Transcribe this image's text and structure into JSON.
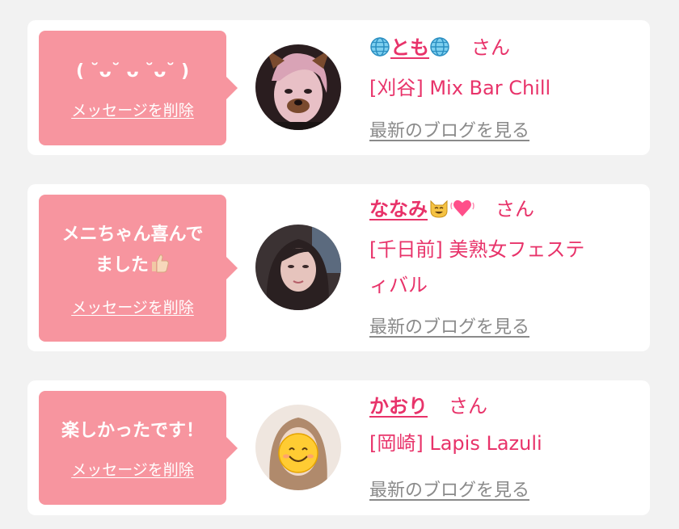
{
  "labels": {
    "san": "さん",
    "delete": "メッセージを削除",
    "blog": "最新のブログを見る"
  },
  "colors": {
    "bubble": "#f7959f",
    "accent": "#e8336a",
    "link_gray": "#8a8a8a",
    "background": "#f2f2f2"
  },
  "messages": [
    {
      "bubble_text": "( ˘ᴗ˘ ᴗ ˘ᴗ˘ )",
      "name": "とも",
      "name_icons": [
        "globe-icon",
        "globe-icon"
      ],
      "shop": "[刈谷] Mix Bar Chill"
    },
    {
      "bubble_text_1": "メニちゃん喜んで",
      "bubble_text_2": "ました",
      "bubble_icon": "thumbs-up-icon",
      "name": "ななみ",
      "name_icons": [
        "cat-face-icon",
        "beating-heart-icon"
      ],
      "shop_1": "[千日前] 美熟女フェステ",
      "shop_2": "ィバル"
    },
    {
      "bubble_text": "楽しかったです！",
      "name": "かおり",
      "shop": "[岡崎] Lapis Lazuli",
      "avatar_overlay": "smiling-face-icon"
    }
  ]
}
